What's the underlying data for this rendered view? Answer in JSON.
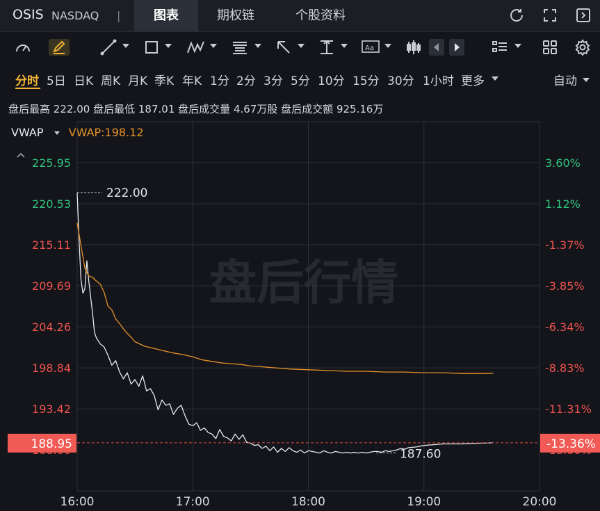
{
  "header": {
    "ticker": "OSIS",
    "exchange": "NASDAQ",
    "separator": "|",
    "tabs": [
      "图表",
      "期权链",
      "个股资料"
    ],
    "active_tab": "图表"
  },
  "top_icons": [
    "refresh-icon",
    "fullscreen-icon",
    "exit-icon"
  ],
  "toolbar_icons": [
    "indicator-icon",
    "pen-icon",
    "line-tool-icon",
    "rectangle-tool-icon",
    "pattern-tool-icon",
    "text-lines-tool-icon",
    "arrow-tool-icon",
    "vertical-measure-icon",
    "text-box-icon",
    "candlestick-icon",
    "prev-arrow-icon",
    "next-arrow-icon",
    "list-icon",
    "grid-icon",
    "settings-icon"
  ],
  "periods": [
    "分时",
    "5日",
    "日K",
    "周K",
    "月K",
    "季K",
    "年K",
    "1分",
    "2分",
    "3分",
    "5分",
    "10分",
    "15分",
    "30分",
    "1小时",
    "更多"
  ],
  "active_period": "分时",
  "auto_label": "自动",
  "info": {
    "high_label": "盘后最高",
    "high": "222.00",
    "low_label": "盘后最低",
    "low": "187.01",
    "volume_label": "盘后成交量",
    "volume": "4.67万股",
    "amount_label": "盘后成交额",
    "amount": "925.16万"
  },
  "indicator": {
    "name": "VWAP",
    "value_label": "VWAP:198.12"
  },
  "watermark": "盘后行情",
  "colors": {
    "up": "#2fc27f",
    "down": "#f0534f",
    "vwap": "#e8922a",
    "accent": "#f3b233",
    "price_line": "#e8eaee"
  },
  "chart_data": {
    "type": "line",
    "y_ticks_left": [
      "225.95",
      "220.53",
      "215.11",
      "209.69",
      "204.26",
      "198.84",
      "193.42",
      "188.00"
    ],
    "y_ticks_right": [
      "3.60%",
      "1.12%",
      "-1.37%",
      "-3.85%",
      "-6.34%",
      "-8.83%",
      "-11.31%",
      "-13.80%"
    ],
    "x_ticks": [
      "16:00",
      "17:00",
      "18:00",
      "19:00",
      "20:00"
    ],
    "xlim": [
      0,
      240
    ],
    "ylim": [
      182.6,
      231.37
    ],
    "current_price": "188.95",
    "current_pct": "-13.36%",
    "high_annotation": "222.00",
    "low_annotation": "187.60",
    "series": [
      {
        "name": "price",
        "x": [
          0,
          1,
          2,
          3,
          4,
          5,
          6,
          7,
          8,
          9,
          10,
          12,
          14,
          16,
          18,
          20,
          22,
          24,
          26,
          28,
          30,
          32,
          34,
          36,
          38,
          40,
          42,
          44,
          46,
          48,
          50,
          52,
          54,
          56,
          58,
          60,
          62,
          64,
          66,
          68,
          70,
          72,
          74,
          76,
          78,
          80,
          82,
          84,
          86,
          88,
          90,
          92,
          94,
          96,
          98,
          100,
          102,
          104,
          106,
          108,
          110,
          112,
          114,
          116,
          118,
          120,
          122,
          124,
          126,
          128,
          130,
          132,
          134,
          136,
          138,
          140,
          142,
          144,
          146,
          148,
          150,
          152,
          154,
          156,
          158,
          160,
          162,
          164,
          166,
          168,
          170,
          172,
          176,
          180,
          185,
          190,
          200,
          210,
          216
        ],
        "y": [
          222.0,
          215.5,
          210.5,
          208.7,
          209.3,
          213.0,
          210.4,
          208.2,
          206.0,
          203.5,
          202.8,
          202.0,
          201.6,
          200.5,
          199.2,
          199.8,
          198.3,
          197.4,
          198.2,
          196.7,
          197.3,
          196.4,
          197.8,
          195.8,
          196.1,
          195.2,
          193.3,
          194.6,
          193.9,
          194.1,
          192.7,
          193.5,
          193.9,
          192.5,
          191.4,
          191.2,
          191.6,
          190.6,
          190.9,
          190.3,
          190.1,
          189.5,
          190.7,
          189.8,
          189.6,
          189.2,
          190.1,
          189.4,
          190.0,
          189.0,
          188.9,
          188.6,
          188.7,
          188.2,
          188.5,
          187.9,
          188.4,
          187.7,
          188.2,
          187.8,
          188.3,
          187.9,
          187.7,
          188.0,
          187.6,
          187.9,
          187.8,
          187.7,
          187.6,
          187.9,
          187.7,
          187.6,
          187.8,
          187.7,
          187.6,
          187.7,
          187.6,
          187.7,
          187.6,
          187.7,
          187.6,
          187.7,
          187.8,
          187.8,
          187.7,
          187.9,
          187.8,
          187.9,
          188.0,
          188.2,
          188.1,
          188.3,
          188.4,
          188.6,
          188.7,
          188.8,
          188.8,
          188.9,
          188.95
        ]
      },
      {
        "name": "VWAP",
        "x": [
          0,
          2,
          4,
          6,
          8,
          10,
          12,
          14,
          16,
          18,
          20,
          22,
          24,
          26,
          28,
          30,
          35,
          40,
          45,
          50,
          55,
          60,
          65,
          70,
          75,
          80,
          85,
          90,
          95,
          100,
          110,
          120,
          130,
          140,
          150,
          160,
          170,
          180,
          190,
          200,
          210,
          216
        ],
        "y": [
          218.0,
          215.0,
          212.0,
          211.0,
          210.8,
          210.3,
          209.9,
          208.8,
          207.0,
          206.5,
          205.3,
          204.7,
          204.0,
          203.4,
          202.9,
          202.3,
          201.7,
          201.4,
          201.1,
          200.8,
          200.6,
          200.3,
          199.9,
          199.7,
          199.5,
          199.4,
          199.3,
          199.1,
          199.0,
          198.9,
          198.7,
          198.6,
          198.5,
          198.4,
          198.4,
          198.3,
          198.3,
          198.2,
          198.2,
          198.1,
          198.1,
          198.12
        ]
      }
    ]
  }
}
